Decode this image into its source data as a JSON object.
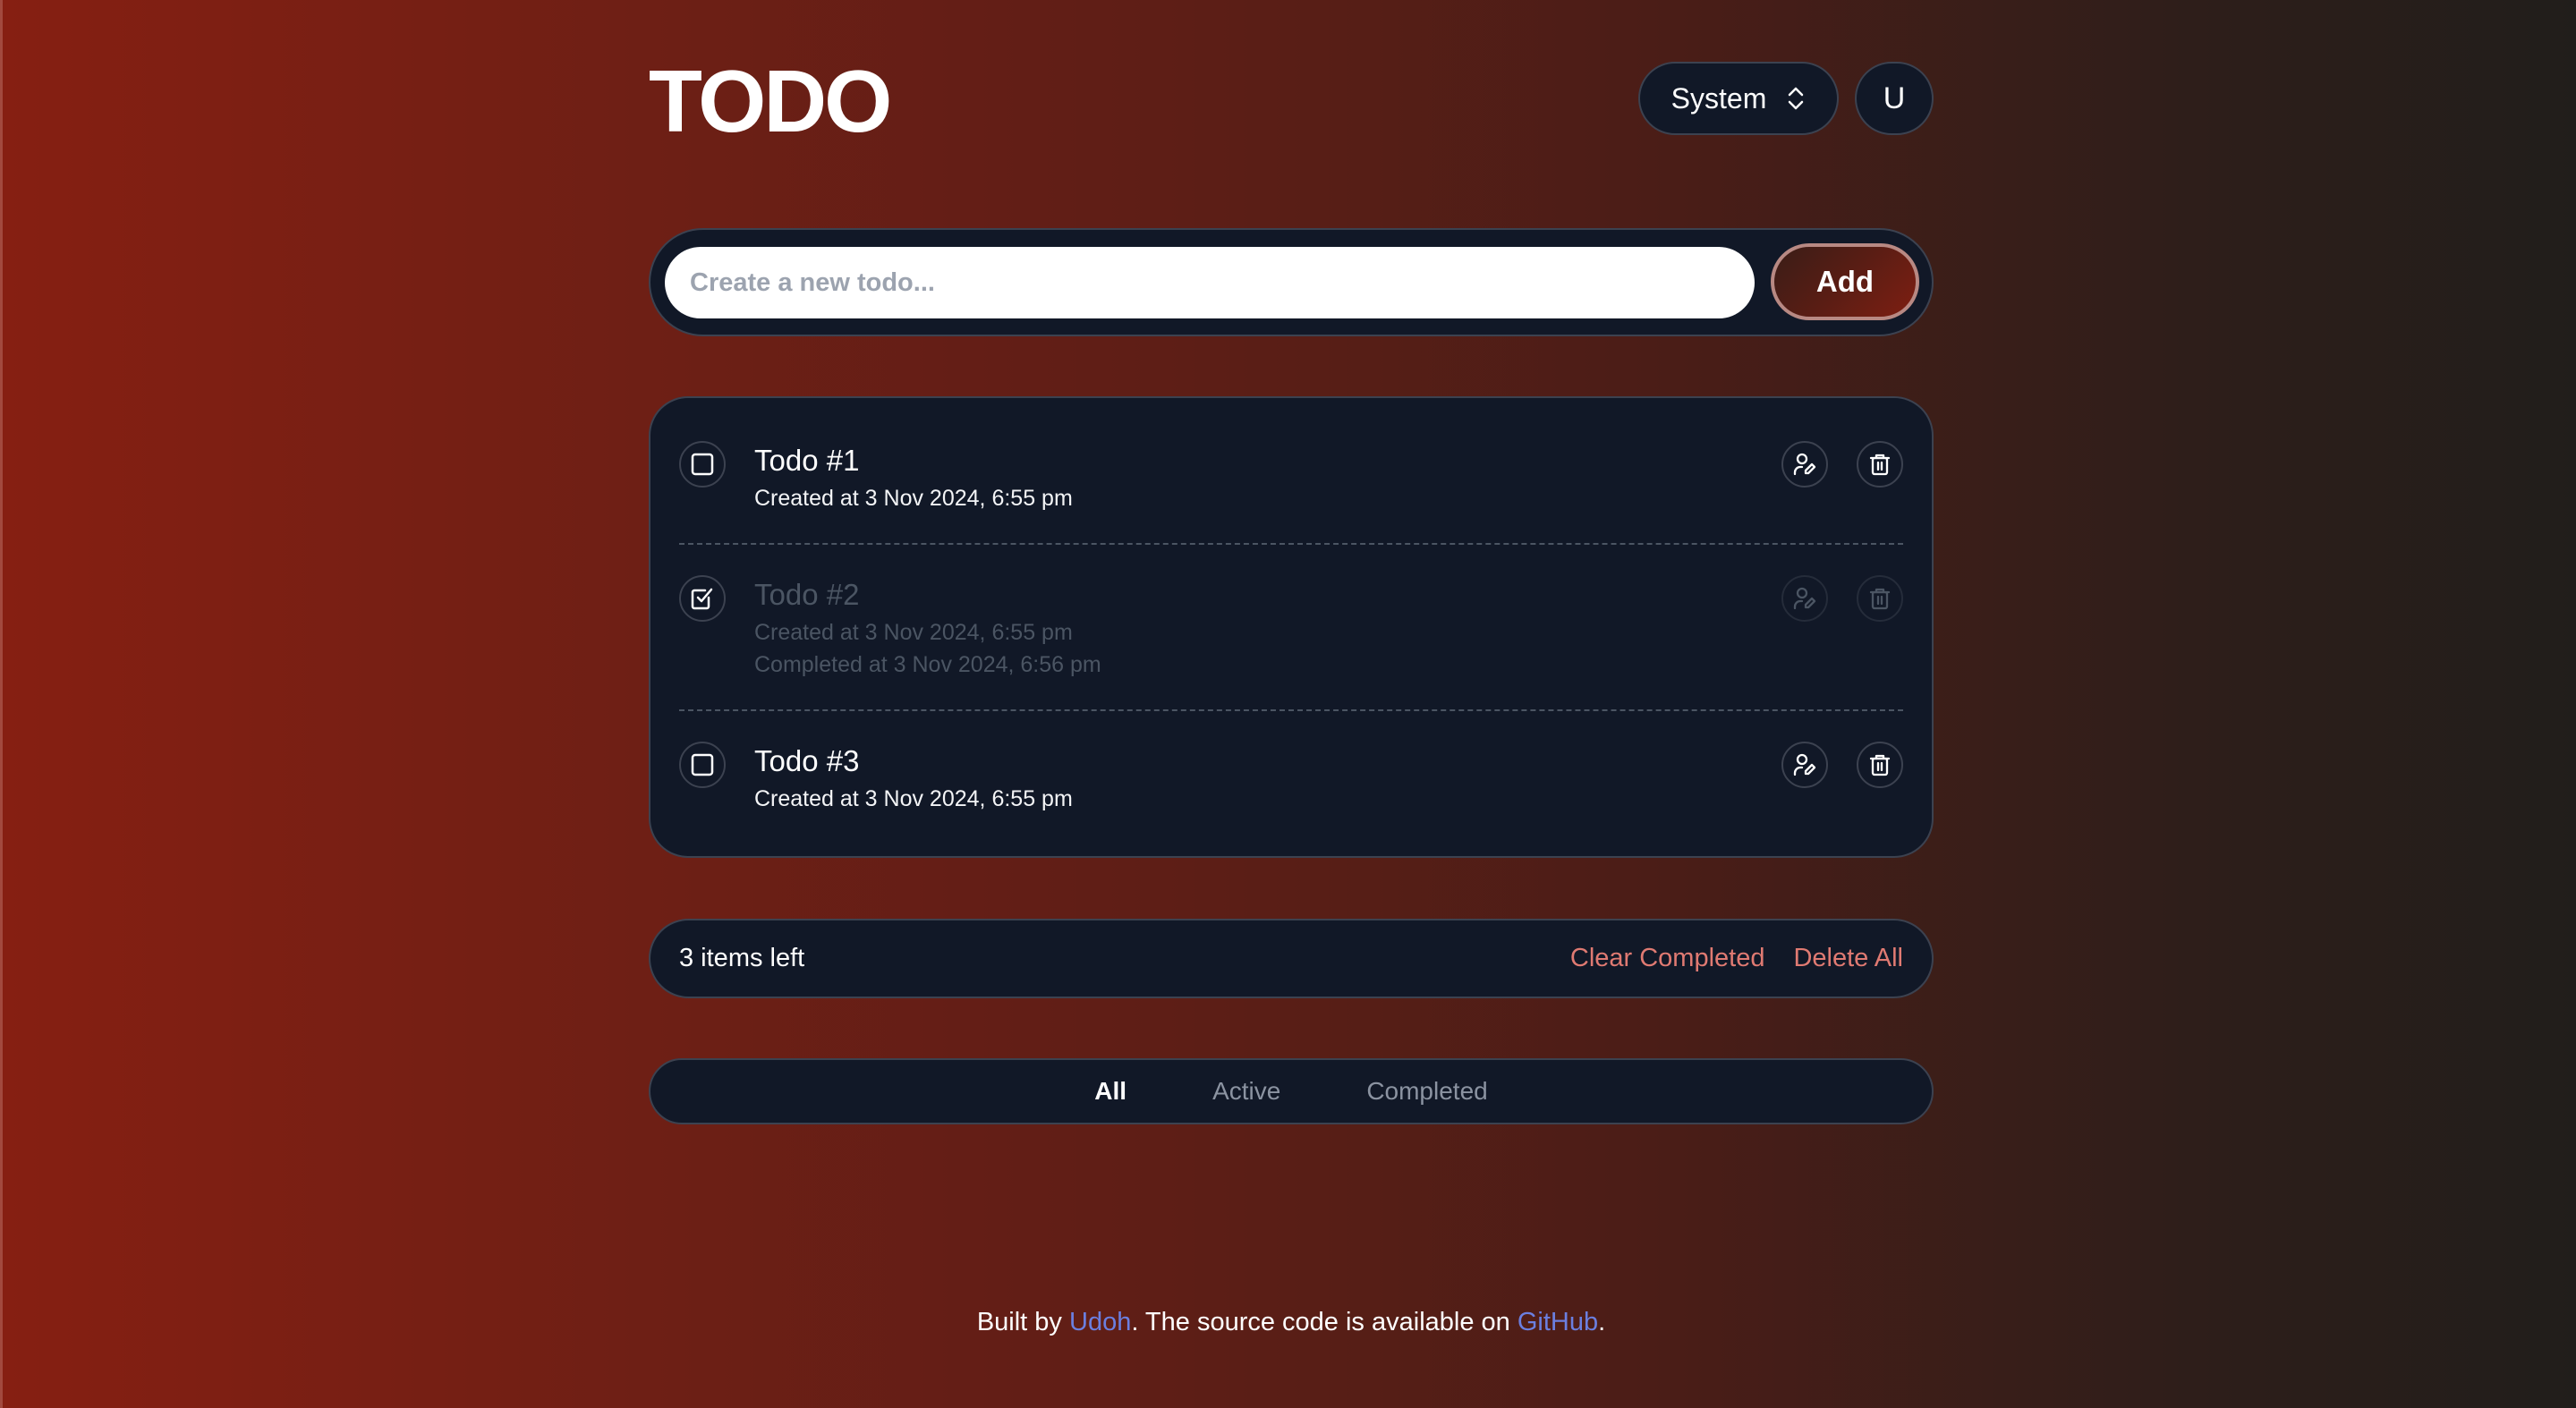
{
  "header": {
    "title": "TODO",
    "theme_select": {
      "selected": "System",
      "icon": "chevron-up-down-icon"
    },
    "user_button": {
      "label": "U"
    }
  },
  "add_form": {
    "input_value": "",
    "placeholder": "Create a new todo...",
    "add_label": "Add"
  },
  "todos": [
    {
      "title": "Todo #1",
      "completed": false,
      "created": "Created at 3 Nov 2024, 6:55 pm",
      "completed_at": null,
      "actions": [
        "assign-user-icon",
        "trash-icon"
      ]
    },
    {
      "title": "Todo #2",
      "completed": true,
      "created": "Created at 3 Nov 2024, 6:55 pm",
      "completed_at": "Completed at 3 Nov 2024, 6:56 pm",
      "actions": [
        "assign-user-icon",
        "trash-icon"
      ]
    },
    {
      "title": "Todo #3",
      "completed": false,
      "created": "Created at 3 Nov 2024, 6:55 pm",
      "completed_at": null,
      "actions": [
        "assign-user-icon",
        "trash-icon"
      ]
    }
  ],
  "summary": {
    "items_left": "3 items left",
    "clear_completed": "Clear Completed",
    "delete_all": "Delete All"
  },
  "filters": {
    "items": [
      "All",
      "Active",
      "Completed"
    ],
    "selected": "All"
  },
  "credits": {
    "prefix": "Built by ",
    "author": "Udoh",
    "middle": ". The source code is available on ",
    "repo": "GitHub",
    "suffix": "."
  },
  "colors": {
    "card_bg": "#111827",
    "accent_red": "#e07a72",
    "link_blue": "#6b7fe0",
    "bg_left": "#861f12",
    "bg_right": "#211e1b"
  }
}
